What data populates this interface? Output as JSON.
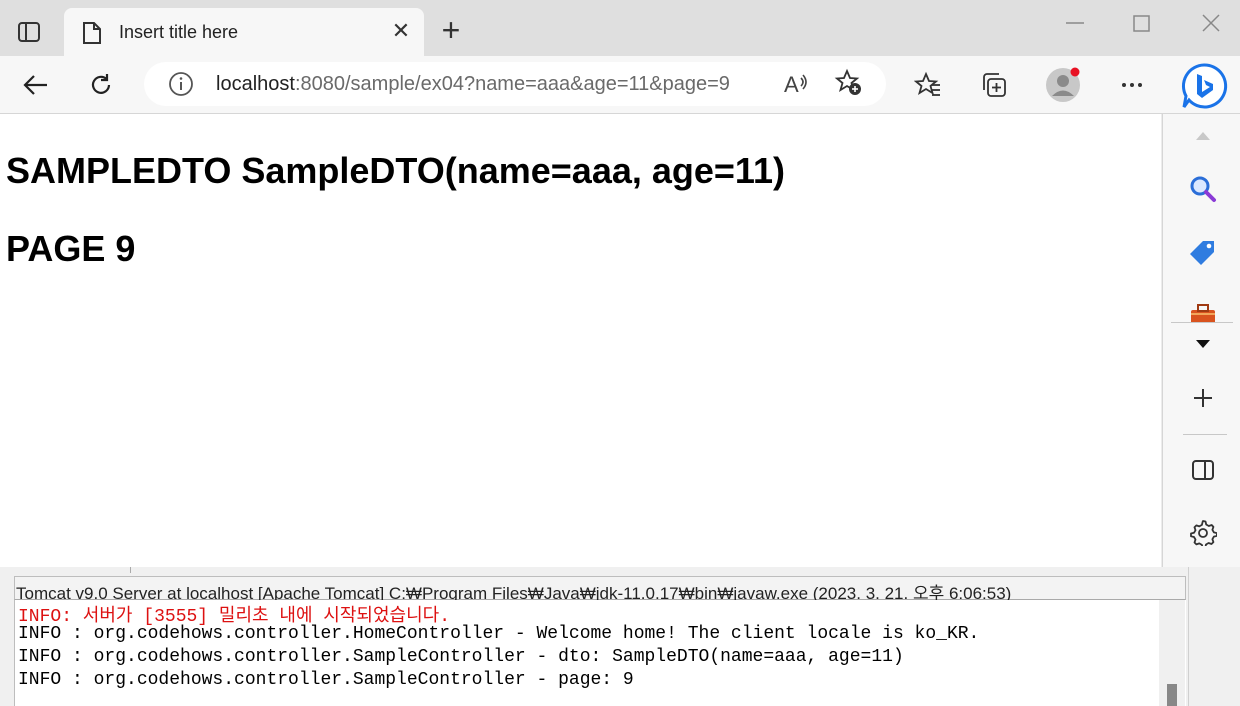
{
  "browser": {
    "tab": {
      "title": "Insert title here"
    },
    "address": {
      "host": "localhost",
      "rest": ":8080/sample/ex04?name=aaa&age=11&page=9"
    }
  },
  "page": {
    "heading1": "SAMPLEDTO SampleDTO(name=aaa, age=11)",
    "heading2": "PAGE 9"
  },
  "console": {
    "header": "Tomcat v9.0 Server at localhost [Apache Tomcat] C:₩Program Files₩Java₩jdk-11.0.17₩bin₩javaw.exe  (2023. 3. 21. 오후 6:06:53)",
    "lines": [
      "INFO: 서버가 [3555] 밀리초 내에 시작되었습니다.",
      "INFO : org.codehows.controller.HomeController - Welcome home! The client locale is ko_KR.",
      "INFO : org.codehows.controller.SampleController - dto: SampleDTO(name=aaa, age=11)",
      "INFO : org.codehows.controller.SampleController - page: 9"
    ]
  },
  "colors": {
    "error_text": "#dd1111",
    "bing_blue": "#1a73e8",
    "notification_dot": "#e81123"
  },
  "icons": {
    "tab_actions": "tab-actions-icon",
    "page": "page-icon",
    "back": "back-arrow-icon",
    "refresh": "refresh-icon",
    "info": "info-icon",
    "read_aloud": "read-aloud-icon",
    "add_favorite": "add-favorite-icon",
    "favorites": "favorites-icon",
    "collections": "collections-icon",
    "profile": "profile-avatar-icon",
    "more": "more-icon",
    "bing": "bing-chat-icon"
  }
}
